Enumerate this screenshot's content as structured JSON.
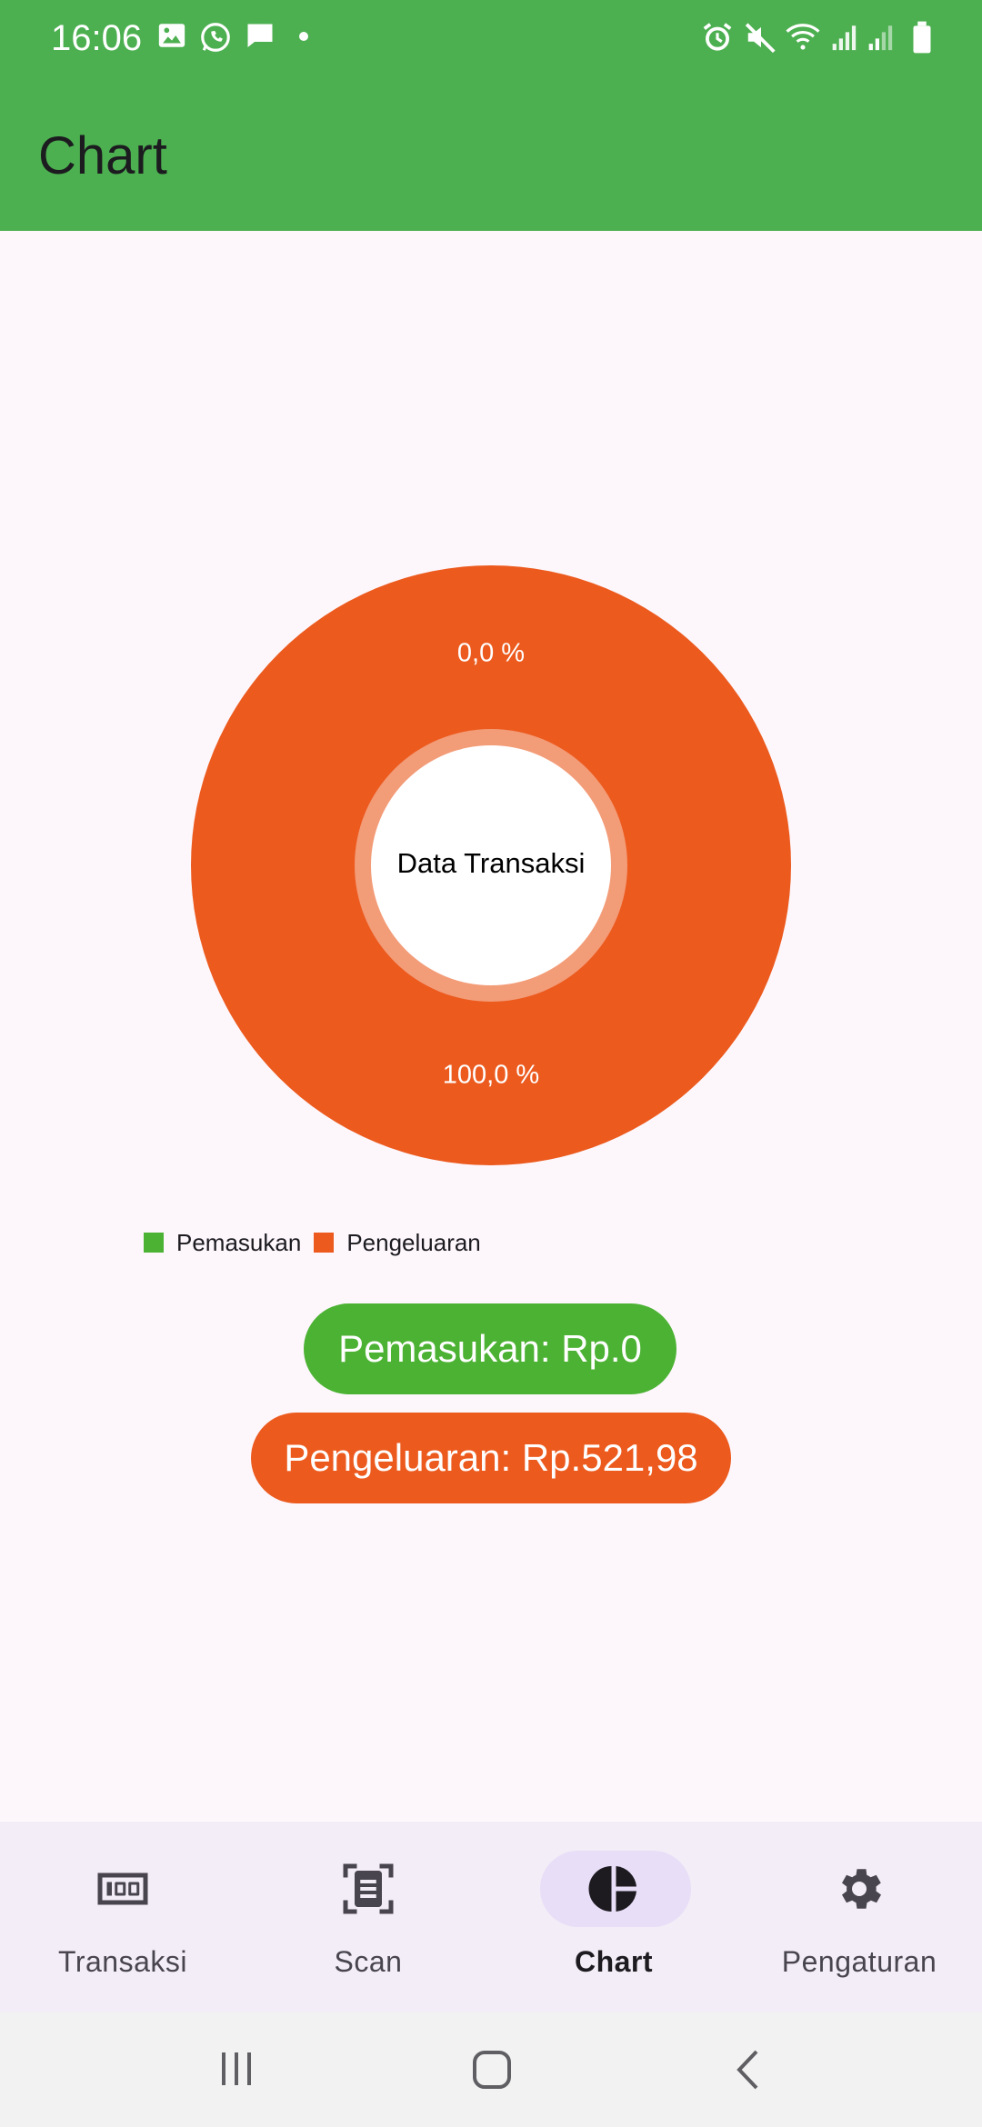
{
  "status_bar": {
    "time": "16:06",
    "left_icons": [
      "gallery-icon",
      "whatsapp-icon",
      "message-icon",
      "dot-icon"
    ],
    "right_icons": [
      "alarm-icon",
      "mute-icon",
      "wifi-icon",
      "signal-icon",
      "signal-icon",
      "battery-icon"
    ]
  },
  "app_bar": {
    "title": "Chart"
  },
  "chart_data": {
    "type": "pie",
    "center_label": "Data Transaksi",
    "categories": [
      "Pemasukan",
      "Pengeluaran"
    ],
    "values": [
      0,
      100
    ],
    "value_labels": [
      "0,0 %",
      "100,0 %"
    ],
    "colors": [
      "#4cb233",
      "#ec5a1e"
    ],
    "legend": [
      "Pemasukan",
      "Pengeluaran"
    ],
    "legend_position": "bottom-left"
  },
  "summary": {
    "income_label": "Pemasukan: Rp.0",
    "expense_label": "Pengeluaran: Rp.521,98"
  },
  "bottom_nav": {
    "items": [
      {
        "label": "Transaksi",
        "icon": "money-icon"
      },
      {
        "label": "Scan",
        "icon": "scan-document-icon"
      },
      {
        "label": "Chart",
        "icon": "pie-chart-icon",
        "active": true
      },
      {
        "label": "Pengaturan",
        "icon": "gear-icon"
      }
    ]
  },
  "system_nav": {
    "icons": [
      "recents-icon",
      "home-icon",
      "back-icon"
    ]
  },
  "colors": {
    "primary_green": "#4caf50",
    "income_green": "#4cb233",
    "expense_orange": "#ec5a1e",
    "background": "#fdf7fc"
  }
}
